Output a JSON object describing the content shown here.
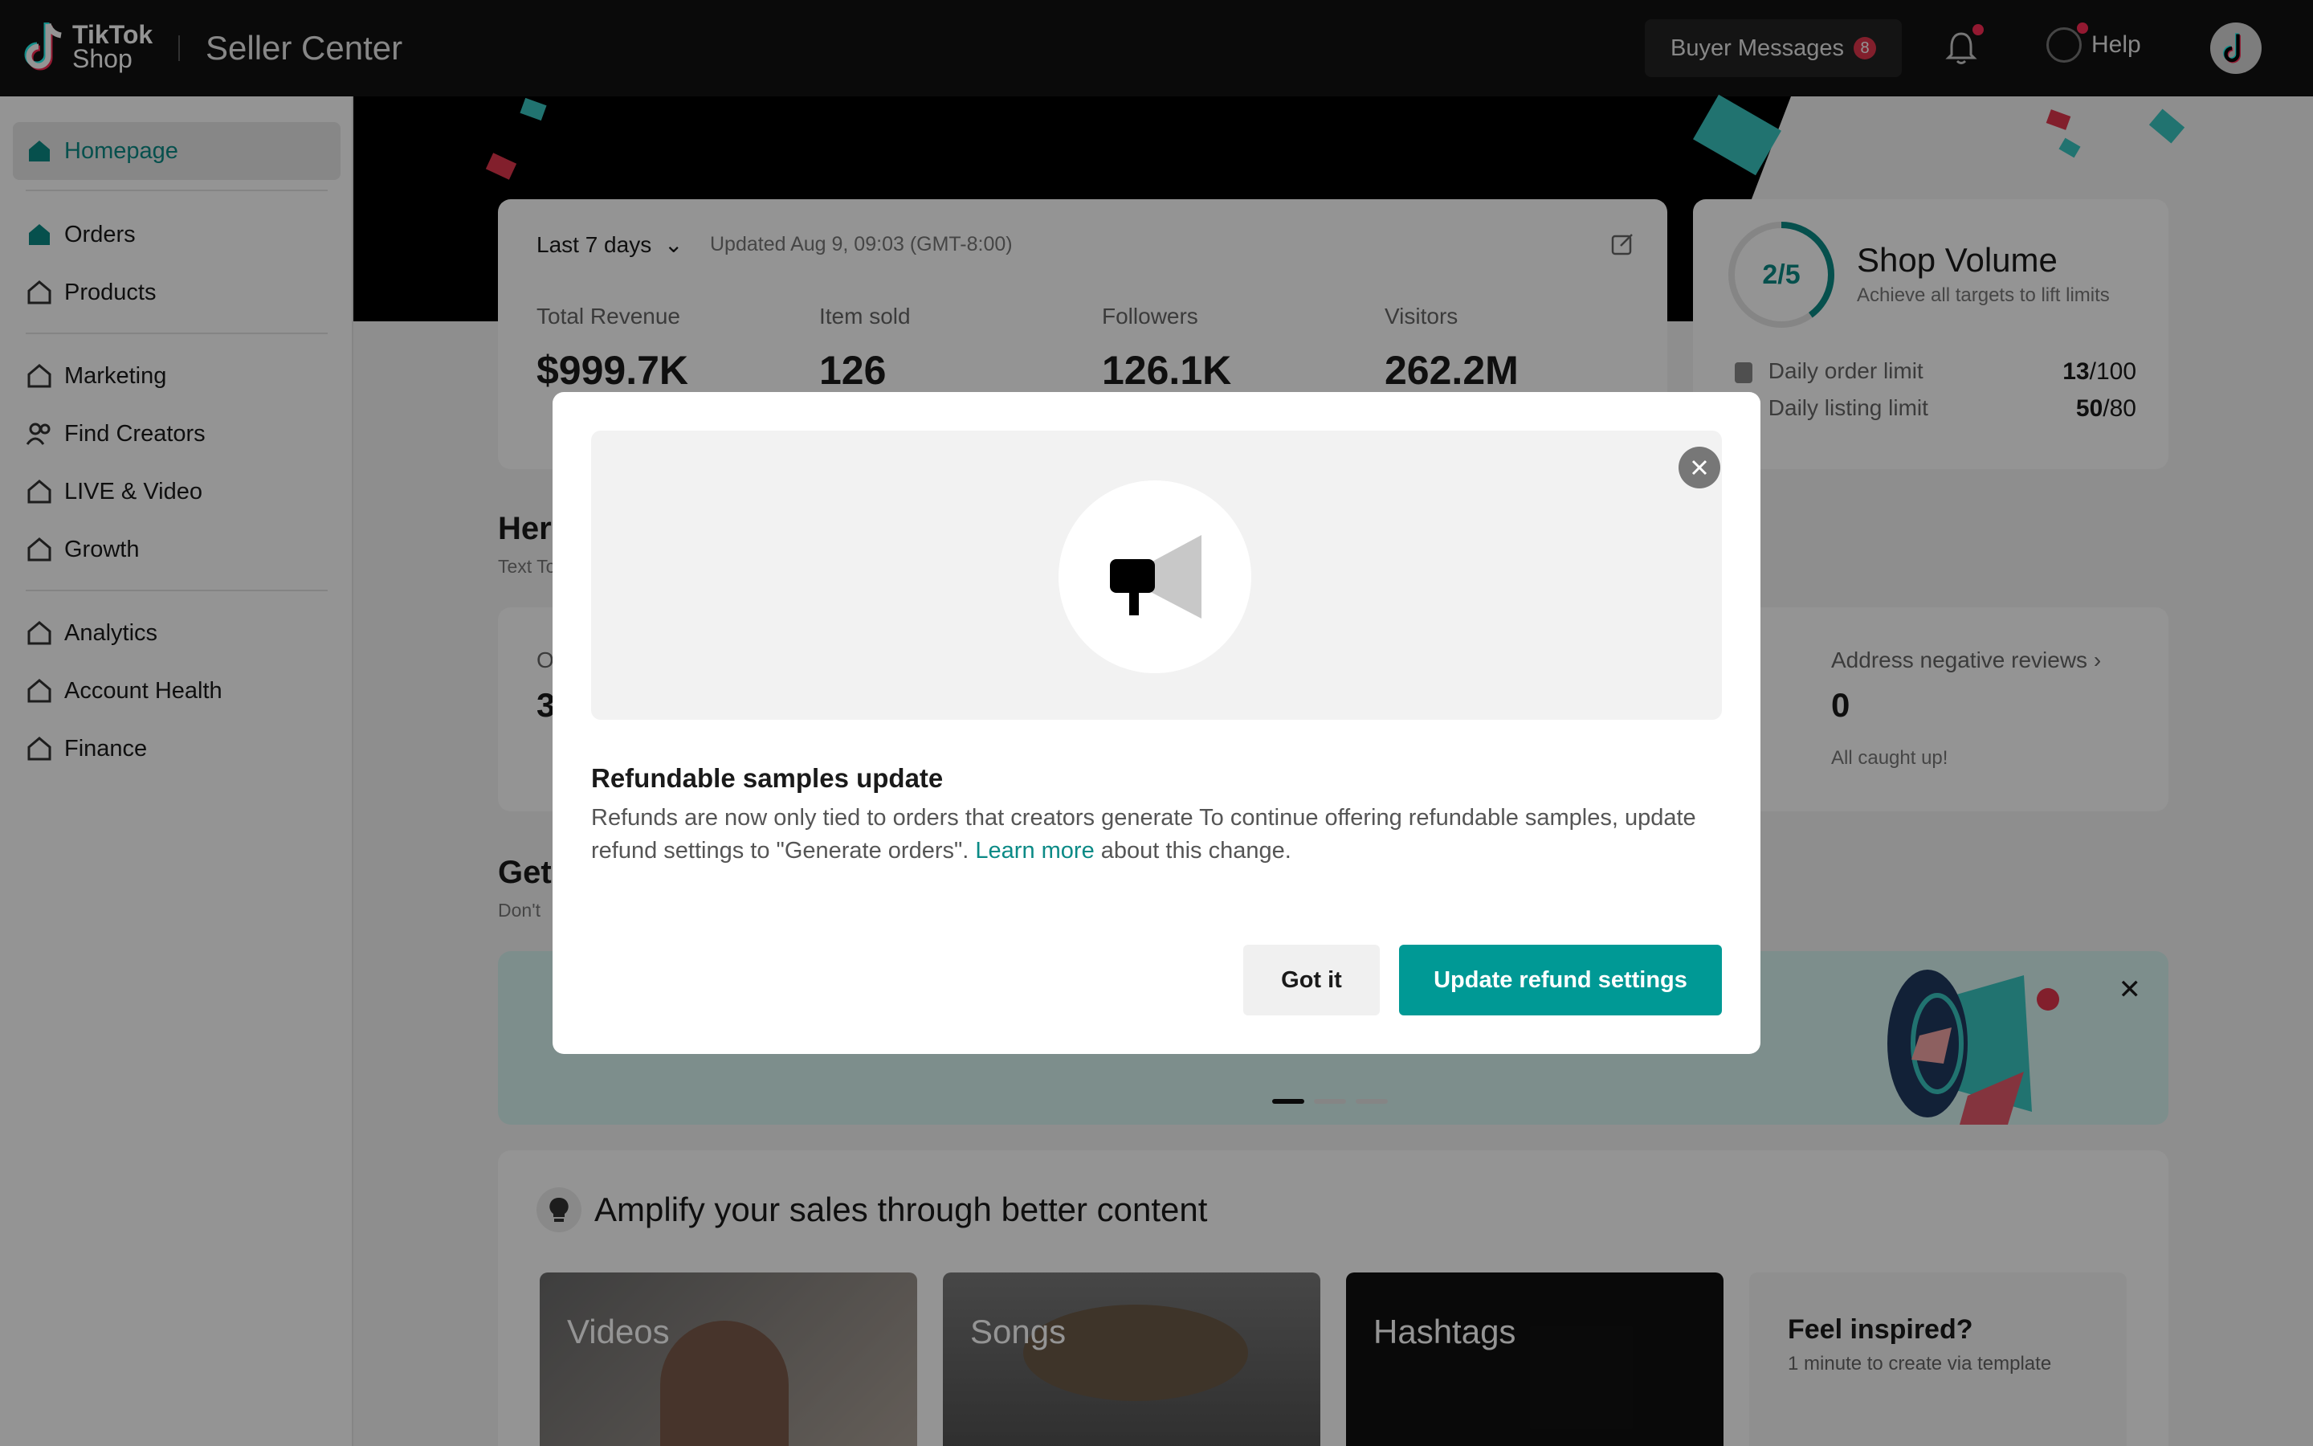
{
  "header": {
    "logo_top": "TikTok",
    "logo_bottom": "Shop",
    "title": "Seller Center",
    "buyer_messages_label": "Buyer Messages",
    "buyer_messages_count": "8",
    "help_label": "Help"
  },
  "sidebar": {
    "items": [
      {
        "label": "Homepage"
      },
      {
        "label": "Orders"
      },
      {
        "label": "Products"
      },
      {
        "label": "Marketing"
      },
      {
        "label": "Find Creators"
      },
      {
        "label": "LIVE & Video"
      },
      {
        "label": "Growth"
      },
      {
        "label": "Analytics"
      },
      {
        "label": "Account Health"
      },
      {
        "label": "Finance"
      }
    ]
  },
  "stats": {
    "period": "Last 7 days",
    "updated": "Updated Aug 9, 09:03 (GMT-8:00)",
    "items": [
      {
        "label": "Total Revenue",
        "value": "$999.7K"
      },
      {
        "label": "Item sold",
        "value": "126"
      },
      {
        "label": "Followers",
        "value": "126.1K"
      },
      {
        "label": "Visitors",
        "value": "262.2M"
      }
    ]
  },
  "shop_volume": {
    "progress": "2/5",
    "progress_fraction": 0.4,
    "title": "Shop Volume",
    "subtitle": "Achieve all targets to lift limits",
    "order_limit_label": "Daily order limit",
    "order_limit_value": "13",
    "order_limit_total": "/100",
    "listing_limit_label": "Daily listing limit",
    "listing_limit_value": "50",
    "listing_limit_total": "/80"
  },
  "tasks": {
    "title_partial": "Her",
    "sub_partial": "Text To",
    "first_label_partial": "O",
    "first_value_partial": "3",
    "neg_title": "Address negative reviews",
    "neg_value": "0",
    "neg_sub": "All caught up!"
  },
  "get_section": {
    "title_partial": "Get",
    "sub_partial": "Don't"
  },
  "amplify": {
    "title": "Amplify your sales through better content",
    "tiles": [
      {
        "label": "Videos"
      },
      {
        "label": "Songs"
      },
      {
        "label": "Hashtags"
      }
    ],
    "inspire_title": "Feel inspired?",
    "inspire_sub": "1 minute to create via template"
  },
  "modal": {
    "title": "Refundable samples update",
    "body_before": "Refunds are now only tied to orders that creators generate To continue offering refundable samples, update refund settings to \"Generate orders\". ",
    "body_link": "Learn more",
    "body_after": " about this change.",
    "btn_secondary": "Got it",
    "btn_primary": "Update refund settings"
  },
  "colors": {
    "accent": "#009995",
    "topbar": "#121212",
    "badge": "#e0364c"
  }
}
